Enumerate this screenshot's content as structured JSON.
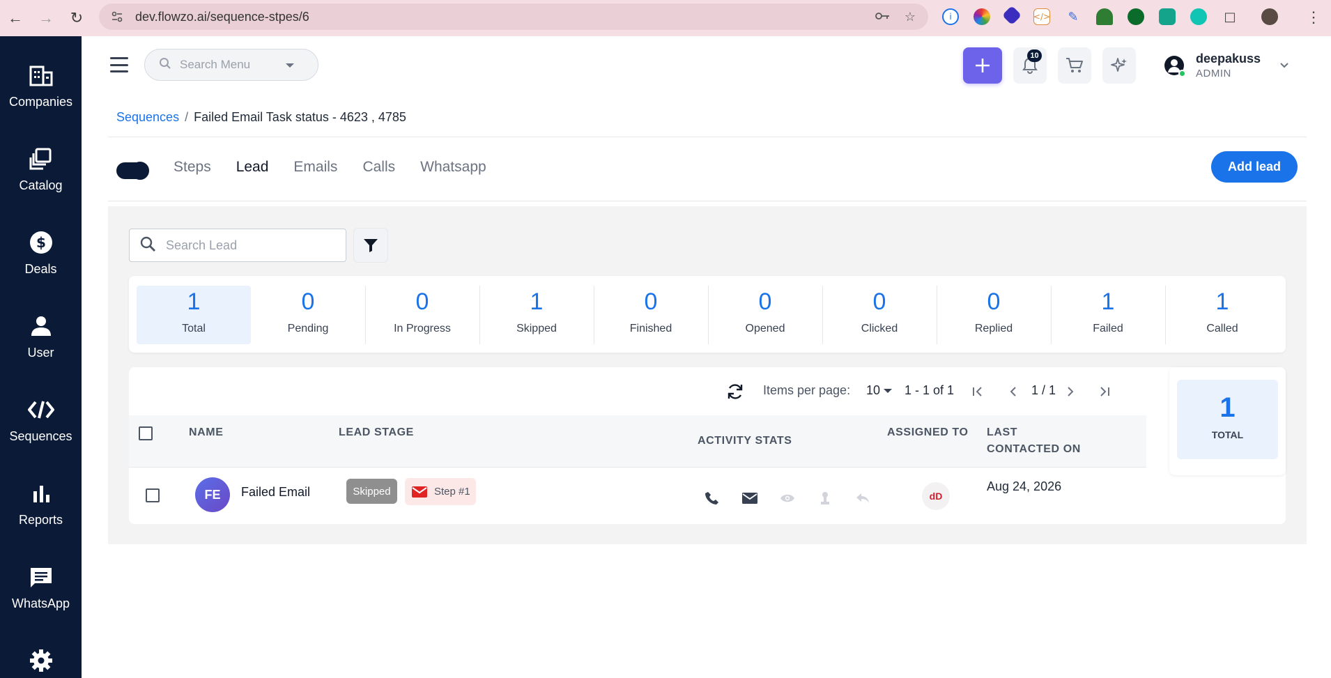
{
  "browser": {
    "url": "dev.flowzo.ai/sequence-stpes/6"
  },
  "sidebar": {
    "items": [
      {
        "label": "Companies",
        "icon": "building-icon"
      },
      {
        "label": "Catalog",
        "icon": "catalog-icon"
      },
      {
        "label": "Deals",
        "icon": "dollar-icon"
      },
      {
        "label": "User",
        "icon": "person-icon"
      },
      {
        "label": "Sequences",
        "icon": "code-icon"
      },
      {
        "label": "Reports",
        "icon": "bar-chart-icon"
      },
      {
        "label": "WhatsApp",
        "icon": "chat-icon"
      },
      {
        "label": "",
        "icon": "gear-icon"
      }
    ]
  },
  "header": {
    "search_placeholder": "Search Menu",
    "notification_count": "10",
    "user": {
      "name": "deepakuss",
      "role": "ADMIN"
    }
  },
  "breadcrumb": {
    "root": "Sequences",
    "separator": "/",
    "current": "Failed Email Task status - 4623 , 4785"
  },
  "tabs": [
    "Steps",
    "Lead",
    "Emails",
    "Calls",
    "Whatsapp"
  ],
  "active_tab": "Lead",
  "add_lead_label": "Add lead",
  "search_lead_placeholder": "Search Lead",
  "stats": [
    {
      "value": "1",
      "label": "Total"
    },
    {
      "value": "0",
      "label": "Pending"
    },
    {
      "value": "0",
      "label": "In Progress"
    },
    {
      "value": "1",
      "label": "Skipped"
    },
    {
      "value": "0",
      "label": "Finished"
    },
    {
      "value": "0",
      "label": "Opened"
    },
    {
      "value": "0",
      "label": "Clicked"
    },
    {
      "value": "0",
      "label": "Replied"
    },
    {
      "value": "1",
      "label": "Failed"
    },
    {
      "value": "1",
      "label": "Called"
    }
  ],
  "pager": {
    "items_per_page_label": "Items per page:",
    "items_per_page": "10",
    "range": "1 - 1 of 1",
    "page": "1 / 1"
  },
  "columns": {
    "name": "NAME",
    "lead_stage": "LEAD STAGE",
    "activity_stats": "ACTIVITY STATS",
    "assigned_to": "ASSIGNED TO",
    "last_contacted_1": "LAST",
    "last_contacted_2": "CONTACTED ON"
  },
  "rows": [
    {
      "initials": "FE",
      "name": "Failed Email",
      "stage": "Skipped",
      "step": "Step #1",
      "assignee": "dD",
      "last_contacted": "Aug 24, 2026"
    }
  ],
  "total_card": {
    "value": "1",
    "label": "TOTAL"
  },
  "colors": {
    "sidebar": "#0b1a36",
    "accent": "#1a73e8",
    "plus_button": "#6d62ea"
  }
}
